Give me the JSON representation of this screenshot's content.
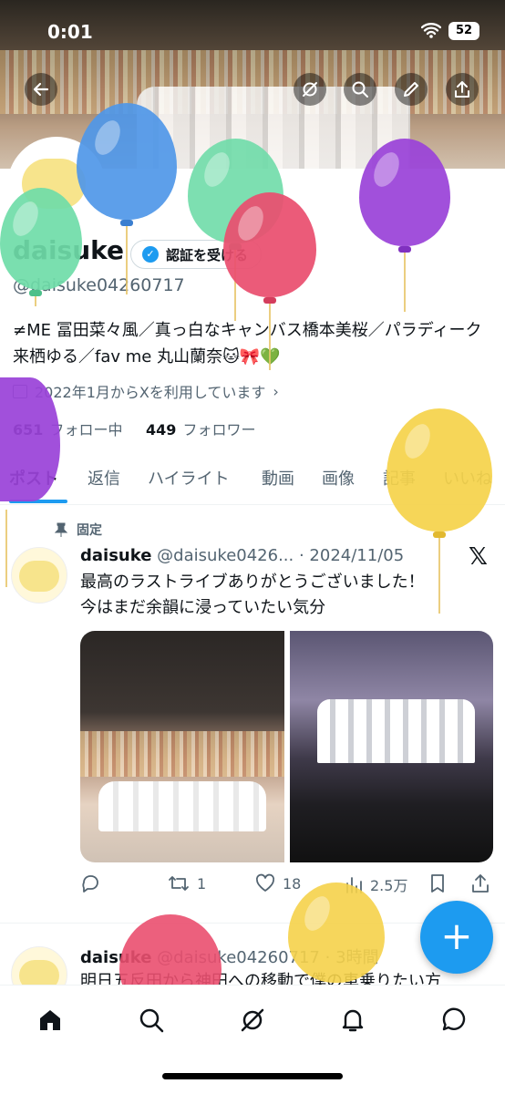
{
  "status_bar": {
    "time": "0:01",
    "battery": "52"
  },
  "profile": {
    "name": "daisuke",
    "verify_label": "認証を受ける",
    "handle": "@daisuke04260717",
    "bio": "≠ME 冨田菜々風／真っ白なキャンバス橋本美桜／パラディーク来栖ゆる／fav me 丸山蘭奈🐱🎀💚",
    "joined": "2022年1月からXを利用しています",
    "following_count": "651",
    "following_label": "フォロー中",
    "followers_count": "449",
    "followers_label": "フォロワー"
  },
  "tabs": [
    "ポスト",
    "返信",
    "ハイライト",
    "動画",
    "画像",
    "記事",
    "いいね"
  ],
  "pinned_label": "固定",
  "tweet1": {
    "name": "daisuke",
    "handle": "@daisuke0426...",
    "date": "· 2024/11/05",
    "line1": "最高のラストライブありがとうございました！",
    "line2": "今はまだ余韻に浸っていたい気分",
    "retweets": "1",
    "likes": "18",
    "views": "2.5万"
  },
  "tweet2": {
    "name": "daisuke",
    "handle": "@daisuke04260717",
    "time": "· 3時間",
    "text": "明日五反田から神田への移動で僕の車乗りたい方"
  },
  "colors": {
    "accent": "#1d9bf0",
    "text": "#0f1419",
    "muted": "#536471"
  },
  "icons": [
    "back-arrow-icon",
    "grok-icon",
    "search-icon",
    "edit-icon",
    "share-icon",
    "calendar-icon",
    "pin-icon",
    "x-logo-icon",
    "reply-icon",
    "retweet-icon",
    "like-icon",
    "views-icon",
    "bookmark-icon",
    "home-icon",
    "notifications-icon",
    "messages-icon"
  ]
}
